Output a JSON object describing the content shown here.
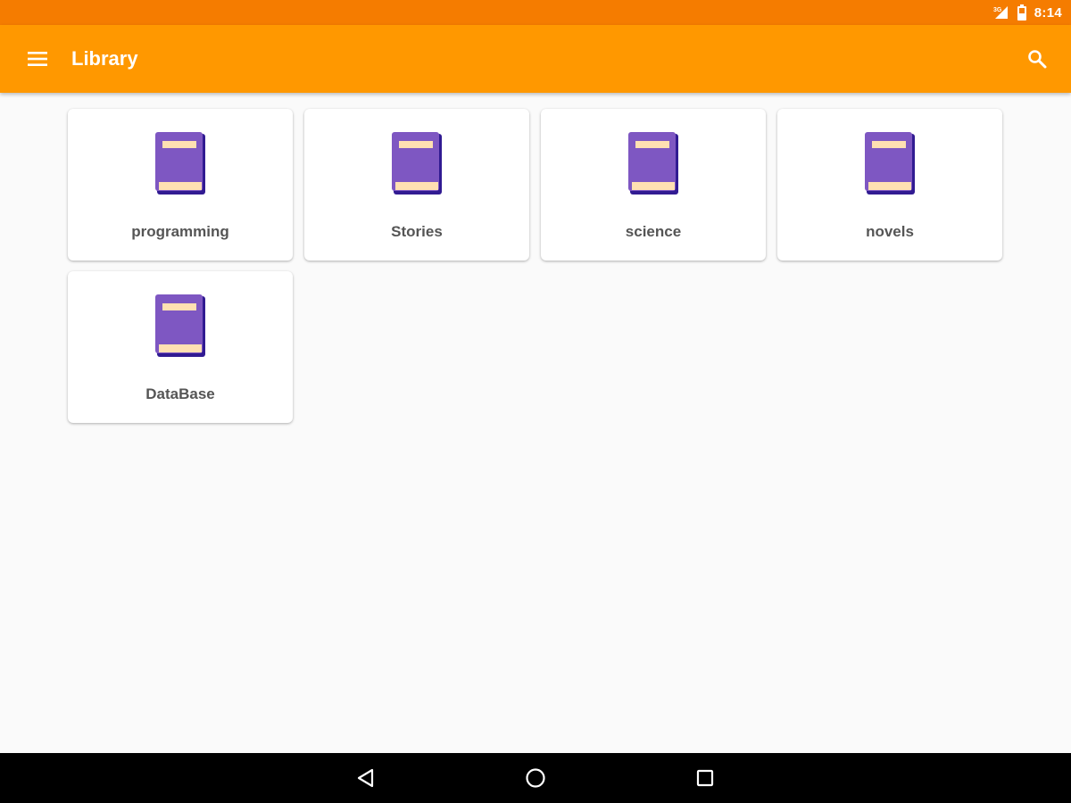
{
  "status_bar": {
    "time": "8:14",
    "icons": [
      "signal-icon",
      "battery-icon"
    ]
  },
  "app_bar": {
    "title": "Library",
    "icons": [
      "menu-icon",
      "search-icon"
    ]
  },
  "categories": [
    {
      "label": "programming",
      "icon": "book-icon"
    },
    {
      "label": "Stories",
      "icon": "book-icon"
    },
    {
      "label": "science",
      "icon": "book-icon"
    },
    {
      "label": "novels",
      "icon": "book-icon"
    },
    {
      "label": "DataBase",
      "icon": "book-icon"
    }
  ],
  "nav_bar": {
    "icons": [
      "back-icon",
      "home-icon",
      "recents-icon"
    ]
  },
  "colors": {
    "status_bar": "#f57c00",
    "app_bar": "#ff9800",
    "background": "#fafafa",
    "book_cover": "#7e57c2",
    "book_spine": "#311b92",
    "book_label": "#ffe0b2",
    "card_text": "#555555"
  }
}
